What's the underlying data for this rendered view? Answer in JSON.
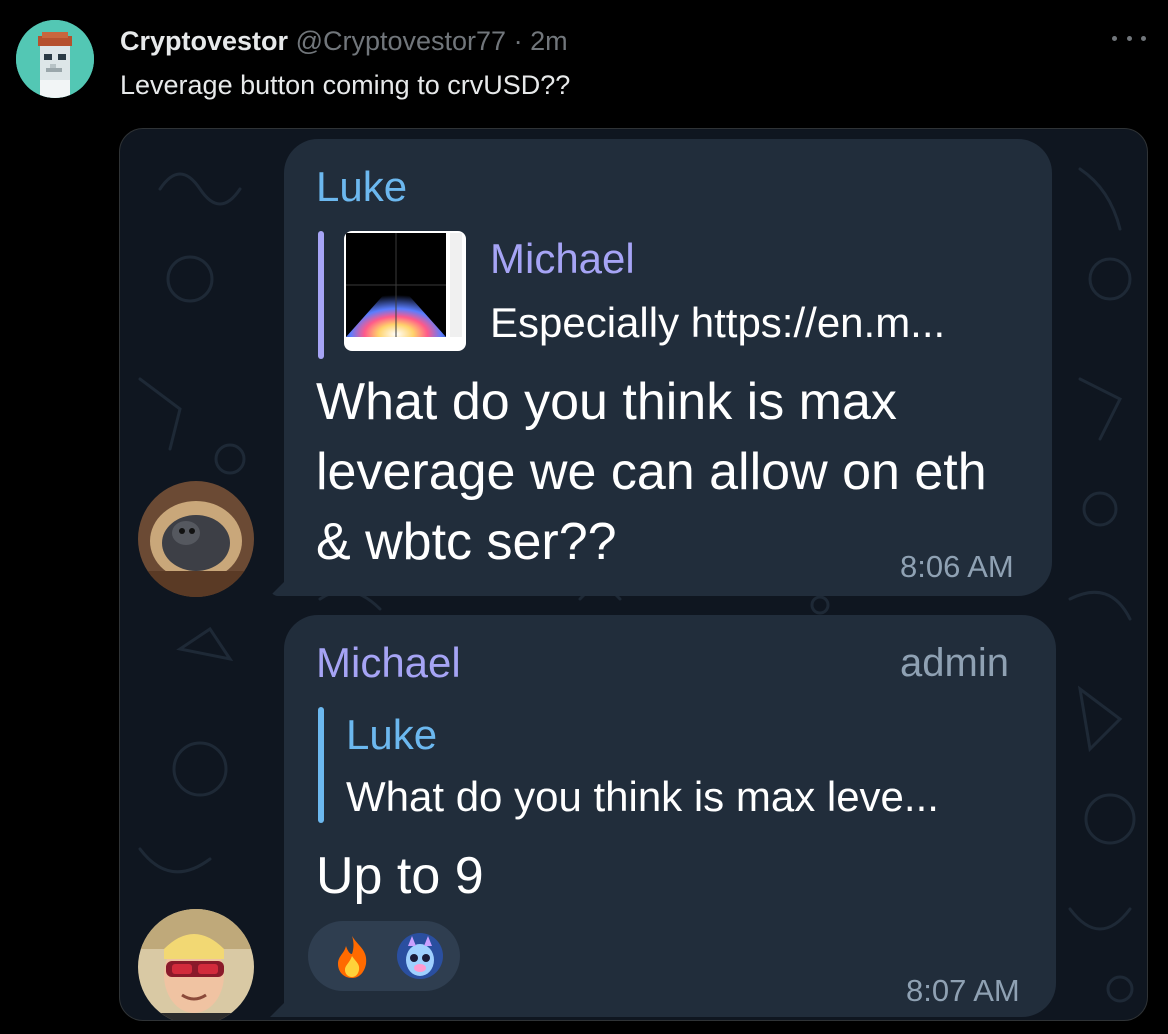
{
  "tweet": {
    "display_name": "Cryptovestor",
    "handle": "@Cryptovestor77",
    "separator": "·",
    "time": "2m",
    "text": "Leverage button coming to crvUSD??"
  },
  "chat": {
    "message1": {
      "sender": "Luke",
      "reply_to": {
        "sender": "Michael",
        "text": "Especially https://en.m..."
      },
      "text": "What do you think is max leverage we can allow on eth & wbtc ser??",
      "time": "8:06 AM"
    },
    "message2": {
      "sender": "Michael",
      "role": "admin",
      "reply_to": {
        "sender": "Luke",
        "text": "What do you think is max leve..."
      },
      "text": "Up to 9",
      "time": "8:07 AM",
      "reactions": [
        "fire-emoji",
        "alien-llama-sticker"
      ]
    }
  },
  "colors": {
    "background": "#000000",
    "chat_background": "#0f1620",
    "bubble": "#212d3b",
    "luke_name": "#6cb8ef",
    "michael_name": "#a6a4f5",
    "meta_text": "#8fa1b3"
  }
}
